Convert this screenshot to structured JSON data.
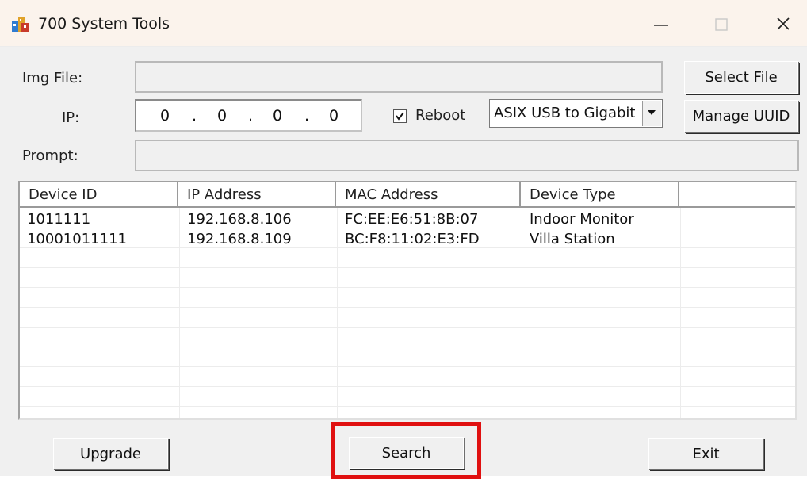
{
  "window": {
    "title": "700 System Tools",
    "controls": {
      "minimize": "—",
      "maximize": "□",
      "close": "✕"
    }
  },
  "form": {
    "img_file_label": "Img File:",
    "img_file_value": "",
    "ip_label": "IP:",
    "ip_octets": [
      "0",
      "0",
      "0",
      "0"
    ],
    "ip_separator": ".",
    "reboot_label": "Reboot",
    "reboot_checked": true,
    "reboot_check_glyph": "✓",
    "adapter_selected": "ASIX USB to Gigabit",
    "prompt_label": "Prompt:",
    "prompt_value": ""
  },
  "buttons": {
    "select_file": "Select File",
    "manage_uuid": "Manage UUID",
    "upgrade": "Upgrade",
    "search": "Search",
    "exit": "Exit"
  },
  "table": {
    "columns": [
      "Device ID",
      "IP Address",
      "MAC Address",
      "Device Type",
      ""
    ],
    "rows": [
      {
        "device_id": "1011111",
        "ip": "192.168.8.106",
        "mac": "FC:EE:E6:51:8B:07",
        "type": "Indoor Monitor"
      },
      {
        "device_id": "10001011111",
        "ip": "192.168.8.109",
        "mac": "BC:F8:11:02:E3:FD",
        "type": "Villa Station"
      }
    ]
  },
  "colors": {
    "highlight": "#e01010",
    "window_bg": "#f0f0f0",
    "titlebar_bg": "#fbf3ec"
  },
  "icons": {
    "app": "app-icon",
    "dropdown": "chevron-down-icon",
    "checkbox": "checkbox-checked-icon"
  }
}
